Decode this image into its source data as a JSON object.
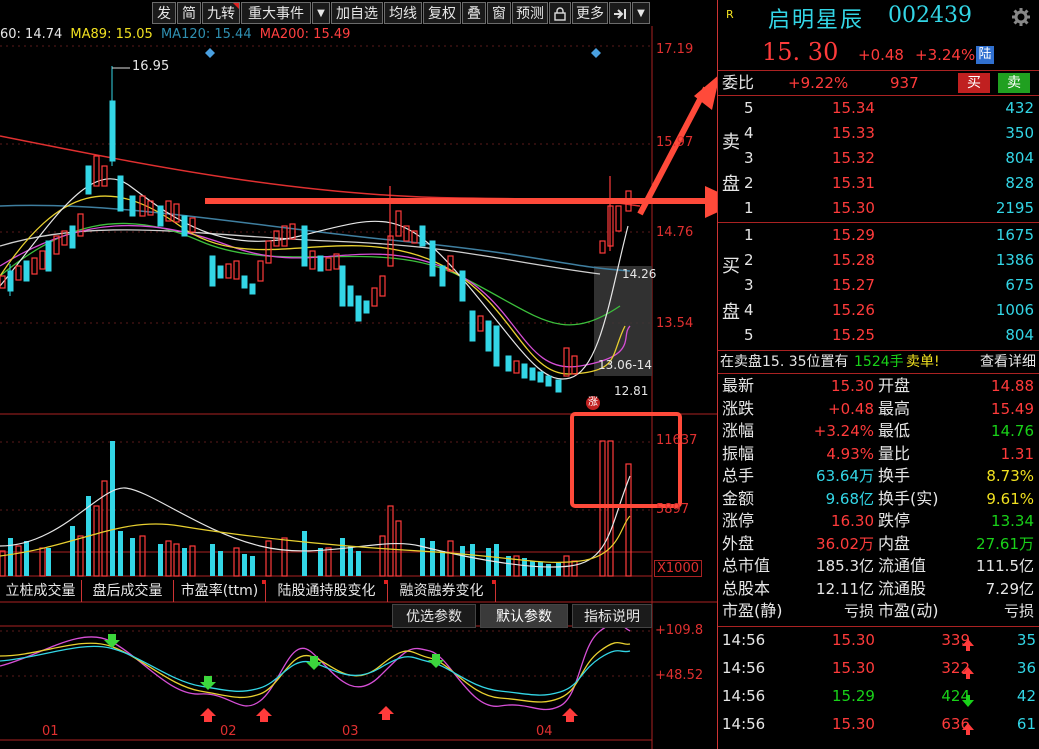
{
  "toolbar": {
    "buttons": [
      "发",
      "简",
      "九转",
      "重大事件",
      "",
      "加自选",
      "均线",
      "复权",
      "叠",
      "窗",
      "预测",
      "",
      "更多",
      "",
      ""
    ]
  },
  "ma": {
    "ma60": "60: 14.74",
    "ma89": "MA89: 15.05",
    "ma120": "MA120: 15.44",
    "ma200": "MA200: 15.49"
  },
  "price_axis": [
    "17.19",
    "15.97",
    "14.76",
    "13.54"
  ],
  "chart_labels": {
    "high": "16.95",
    "box_top": "14.26",
    "box_bottom": "13.06-14",
    "low": "12.81",
    "zhang": "涨"
  },
  "volume_axis": {
    "top": "11637",
    "mid": "5897",
    "unit": "X1000"
  },
  "tabs": [
    "立桩成交量",
    "盘后成交量",
    "市盈率(ttm)",
    "陆股通持股变化",
    "融资融券变化"
  ],
  "params": [
    "优选参数",
    "默认参数",
    "指标说明"
  ],
  "kdj_axis": {
    "top": "+109.8",
    "mid": "+48.52"
  },
  "months": [
    "01",
    "02",
    "03",
    "04"
  ],
  "stock": {
    "badge": "R",
    "name": "启明星辰",
    "code": "002439",
    "price": "15. 30",
    "change": "+0.48",
    "pct": "+3.24%",
    "market": "陆"
  },
  "weibi": {
    "label": "委比",
    "value": "+9.22%",
    "diff": "937",
    "buy_btn": "买",
    "sell_btn": "卖"
  },
  "sell_orders": [
    {
      "level": "5",
      "price": "15.34",
      "vol": "432"
    },
    {
      "level": "4",
      "price": "15.33",
      "vol": "350"
    },
    {
      "level": "3",
      "price": "15.32",
      "vol": "804"
    },
    {
      "level": "2",
      "price": "15.31",
      "vol": "828"
    },
    {
      "level": "1",
      "price": "15.30",
      "vol": "2195"
    }
  ],
  "buy_orders": [
    {
      "level": "1",
      "price": "15.29",
      "vol": "1675"
    },
    {
      "level": "2",
      "price": "15.28",
      "vol": "1386"
    },
    {
      "level": "3",
      "price": "15.27",
      "vol": "675"
    },
    {
      "level": "4",
      "price": "15.26",
      "vol": "1006"
    },
    {
      "level": "5",
      "price": "15.25",
      "vol": "804"
    }
  ],
  "side_labels": {
    "sell": [
      "卖",
      "盘"
    ],
    "buy": [
      "买",
      "盘"
    ]
  },
  "notice": {
    "text": "在卖盘15. 35位置有",
    "qty": "1524手",
    "tag": "卖单!",
    "link": "查看详细"
  },
  "quote": [
    {
      "l": "最新",
      "v": "15.30",
      "l2": "开盘",
      "v2": "14.88",
      "c": "red",
      "c2": "red"
    },
    {
      "l": "涨跌",
      "v": "+0.48",
      "l2": "最高",
      "v2": "15.49",
      "c": "red",
      "c2": "red"
    },
    {
      "l": "涨幅",
      "v": "+3.24%",
      "l2": "最低",
      "v2": "14.76",
      "c": "red",
      "c2": "green"
    },
    {
      "l": "振幅",
      "v": "4.93%",
      "l2": "量比",
      "v2": "1.31",
      "c": "red",
      "c2": "red"
    },
    {
      "l": "总手",
      "v": "63.64万",
      "l2": "换手",
      "v2": "8.73%",
      "c": "cyan",
      "c2": "yellow"
    },
    {
      "l": "金额",
      "v": "9.68亿",
      "l2": "换手(实)",
      "v2": "9.61%",
      "c": "cyan",
      "c2": "yellow"
    },
    {
      "l": "涨停",
      "v": "16.30",
      "l2": "跌停",
      "v2": "13.34",
      "c": "red",
      "c2": "green"
    },
    {
      "l": "外盘",
      "v": "36.02万",
      "l2": "内盘",
      "v2": "27.61万",
      "c": "red",
      "c2": "green"
    },
    {
      "l": "总市值",
      "v": "185.3亿",
      "l2": "流通值",
      "v2": "111.5亿",
      "c": "white",
      "c2": "white"
    },
    {
      "l": "总股本",
      "v": "12.11亿",
      "l2": "流通股",
      "v2": "7.29亿",
      "c": "white",
      "c2": "white"
    },
    {
      "l": "市盈(静)",
      "v": "亏损",
      "l2": "市盈(动)",
      "v2": "亏损",
      "c": "white",
      "c2": "white"
    }
  ],
  "ticks": [
    {
      "t": "14:56",
      "p": "15.30",
      "v": "339",
      "dir": "up",
      "n": "35",
      "c": "red"
    },
    {
      "t": "14:56",
      "p": "15.30",
      "v": "322",
      "dir": "up",
      "n": "36",
      "c": "red"
    },
    {
      "t": "14:56",
      "p": "15.29",
      "v": "424",
      "dir": "down",
      "n": "42",
      "c": "green"
    },
    {
      "t": "14:56",
      "p": "15.30",
      "v": "636",
      "dir": "up",
      "n": "61",
      "c": "red"
    }
  ]
}
